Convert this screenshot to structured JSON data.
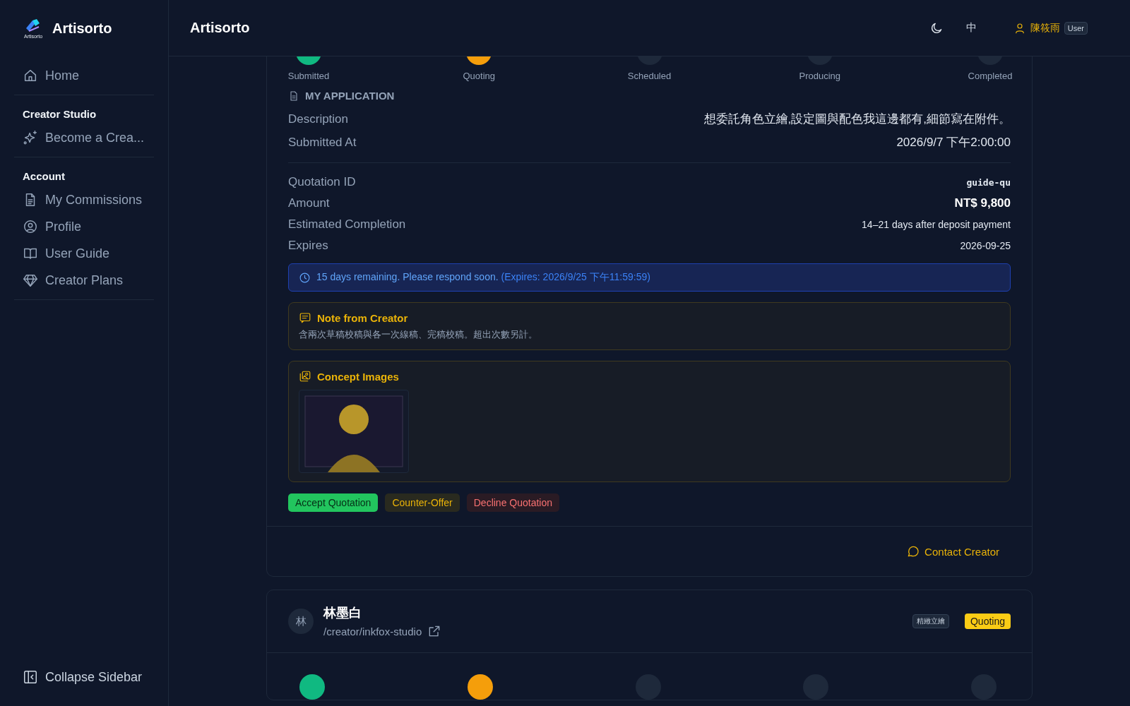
{
  "sidebar": {
    "brand": "Artisorto",
    "logo_caption": "Artisorto",
    "sections": [
      {
        "items": [
          {
            "label": "Home"
          }
        ]
      },
      {
        "title": "Creator Studio",
        "items": [
          {
            "label": "Become a Crea..."
          }
        ]
      },
      {
        "title": "Account",
        "items": [
          {
            "label": "My Commissions"
          },
          {
            "label": "Profile"
          },
          {
            "label": "User Guide"
          },
          {
            "label": "Creator Plans"
          }
        ]
      }
    ],
    "collapse": "Collapse Sidebar"
  },
  "header": {
    "title": "Artisorto",
    "language": "中",
    "user_name": "陳筱雨",
    "role": "User"
  },
  "commission": {
    "steps": [
      {
        "label": "Submitted",
        "done": true,
        "current": false
      },
      {
        "label": "Quoting",
        "done": false,
        "current": true
      },
      {
        "label": "Scheduled",
        "done": false,
        "current": false
      },
      {
        "label": "Producing",
        "done": false,
        "current": false
      },
      {
        "label": "Completed",
        "done": false,
        "current": false
      }
    ],
    "application_title": "MY APPLICATION",
    "application": [
      {
        "label": "Description",
        "value": "想委託角色立繪,設定圖與配色我這邊都有,細節寫在附件。",
        "kind": "plain"
      },
      {
        "label": "Submitted At",
        "value": "2026/9/7 下午2:00:00",
        "kind": "plain"
      }
    ],
    "quotation": [
      {
        "label": "Quotation ID",
        "value": "guide-qu",
        "kind": "code"
      },
      {
        "label": "Amount",
        "value": "NT$ 9,800",
        "kind": "strong"
      },
      {
        "label": "Estimated Completion",
        "value": "14–21 days after deposit payment",
        "kind": "small"
      },
      {
        "label": "Expires",
        "value": "2026-09-25",
        "kind": "small"
      }
    ],
    "deadline": {
      "message": "15 days remaining. Please respond soon.",
      "detail": "(Expires: 2026/9/25 下午11:59:59)"
    },
    "note": {
      "title": "Note from Creator",
      "text": "含兩次草稿校稿與各一次線稿、完稿校稿。超出次數另計。"
    },
    "concept": {
      "title": "Concept Images"
    },
    "actions": [
      {
        "label": "Accept Quotation",
        "kind": "accept"
      },
      {
        "label": "Counter-Offer",
        "kind": "counter"
      },
      {
        "label": "Decline Quotation",
        "kind": "decline"
      }
    ],
    "contact": "Contact Creator"
  },
  "next_commission": {
    "avatar": "林",
    "name": "林墨白",
    "path": "/creator/inkfox-studio",
    "tag": "精緻立繪",
    "status": "Quoting",
    "steps": [
      {
        "done": true,
        "current": false
      },
      {
        "done": false,
        "current": true
      },
      {
        "done": false,
        "current": false
      },
      {
        "done": false,
        "current": false
      },
      {
        "done": false,
        "current": false
      }
    ]
  }
}
